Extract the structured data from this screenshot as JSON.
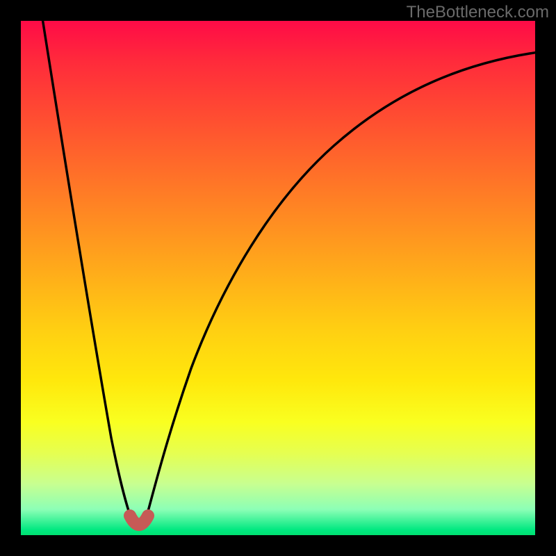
{
  "attribution": "TheBottleneck.com",
  "chart_data": {
    "type": "line",
    "title": "",
    "xlabel": "",
    "ylabel": "",
    "xlim": [
      0,
      100
    ],
    "ylim": [
      0,
      100
    ],
    "note": "Qualitative bottleneck curve on a red-to-green vertical gradient. Two black curves descend to a common minimum near x≈22, y≈2; left branch falls steeply from top-left, right branch rises gradually toward top-right. A short salmon U-shaped marker highlights the minimum.",
    "series": [
      {
        "name": "left-branch",
        "x": [
          4,
          6,
          8,
          10,
          12,
          14,
          16,
          18,
          20,
          21,
          22
        ],
        "values": [
          100,
          89,
          78,
          67,
          56,
          45,
          34,
          23,
          12,
          6,
          2
        ]
      },
      {
        "name": "right-branch",
        "x": [
          22,
          24,
          26,
          28,
          31,
          35,
          40,
          46,
          53,
          61,
          70,
          80,
          90,
          100
        ],
        "values": [
          2,
          11,
          20,
          28,
          38,
          48,
          58,
          67,
          74,
          80,
          84,
          87,
          89,
          90
        ]
      }
    ],
    "marker": {
      "x": 22,
      "y": 2,
      "label": "minimum"
    },
    "gradient_stops": [
      {
        "pct": 0,
        "color": "#ff0b47"
      },
      {
        "pct": 60,
        "color": "#ffcf12"
      },
      {
        "pct": 100,
        "color": "#00e070"
      }
    ]
  }
}
